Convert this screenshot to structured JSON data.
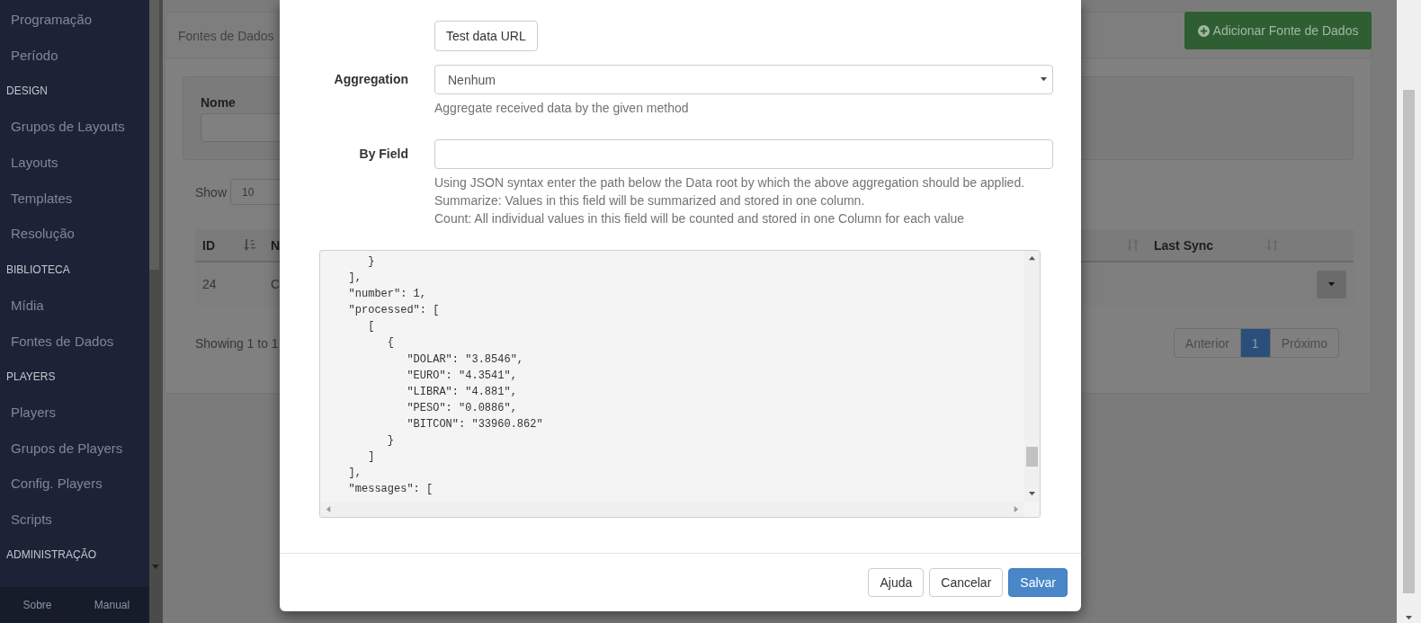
{
  "sidebar": {
    "items": [
      {
        "kind": "link",
        "label": "Programação"
      },
      {
        "kind": "link",
        "label": "Período"
      },
      {
        "kind": "heading",
        "label": "DESIGN"
      },
      {
        "kind": "link",
        "label": "Grupos de Layouts"
      },
      {
        "kind": "link",
        "label": "Layouts"
      },
      {
        "kind": "link",
        "label": "Templates"
      },
      {
        "kind": "link",
        "label": "Resolução"
      },
      {
        "kind": "heading",
        "label": "BIBLIOTECA"
      },
      {
        "kind": "link",
        "label": "Mídia"
      },
      {
        "kind": "link",
        "label": "Fontes de Dados"
      },
      {
        "kind": "heading",
        "label": "PLAYERS"
      },
      {
        "kind": "link",
        "label": "Players"
      },
      {
        "kind": "link",
        "label": "Grupos de Players"
      },
      {
        "kind": "link",
        "label": "Config. Players"
      },
      {
        "kind": "link",
        "label": "Scripts"
      },
      {
        "kind": "heading",
        "label": "ADMINISTRAÇÃO"
      }
    ],
    "footer_links": [
      "Sobre",
      "Manual"
    ]
  },
  "page": {
    "title": "Fontes de Dados",
    "add_button": "Adicionar Fonte de Dados",
    "filter": {
      "label": "Nome"
    },
    "length": {
      "label": "Show",
      "value": "10"
    },
    "table": {
      "left_columns": [
        {
          "label": "ID",
          "sorted": true
        },
        {
          "label": "N"
        }
      ],
      "right_columns": [
        {
          "sorted": false
        },
        {
          "label": "Last Sync",
          "sorted": false
        }
      ],
      "rows": [
        {
          "cells": [
            "24",
            "C"
          ]
        }
      ]
    },
    "info": "Showing 1 to 1",
    "pagination": [
      {
        "label": "Anterior",
        "selected": false
      },
      {
        "label": "1",
        "selected": true
      },
      {
        "label": "Próximo",
        "selected": false
      }
    ]
  },
  "modal": {
    "test_button": "Test data URL",
    "fields": [
      {
        "kind": "select",
        "label": "Aggregation",
        "value": "Nenhum",
        "help": [
          "Aggregate received data by the given method"
        ]
      },
      {
        "kind": "text",
        "label": "By Field",
        "help": [
          "Using JSON syntax enter the path below the Data root by which the above aggregation should be applied.",
          "Summarize: Values in this field will be summarized and stored in one column.",
          "Count: All individual values in this field will be counted and stored in one Column for each value"
        ]
      }
    ],
    "code_lines": [
      "      }",
      "   ],",
      "   \"number\": 1,",
      "   \"processed\": [",
      "      [",
      "         {",
      "            \"DOLAR\": \"3.8546\",",
      "            \"EURO\": \"4.3541\",",
      "            \"LIBRA\": \"4.881\",",
      "            \"PESO\": \"0.0886\",",
      "            \"BITCON\": \"33960.862\"",
      "         }",
      "      ]",
      "   ],",
      "   \"messages\": ["
    ],
    "buttons": [
      {
        "label": "Ajuda",
        "kind": "default"
      },
      {
        "label": "Cancelar",
        "kind": "default"
      },
      {
        "label": "Salvar",
        "kind": "primary"
      }
    ]
  }
}
